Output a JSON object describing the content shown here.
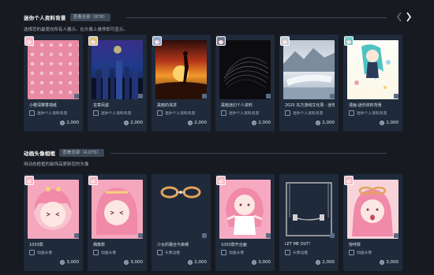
{
  "sections": [
    {
      "title": "迷你个人资料背景",
      "view_all": "查看全部（878）",
      "desc": "选择您的最爱向所有人展示。在头像上悬停即可显示。",
      "items": [
        {
          "name": "小樱深樱香墙纸",
          "type": "迷你个人资料背景",
          "price": "2,000"
        },
        {
          "name": "龙章凤姿",
          "type": "迷你个人资料背景",
          "price": "2,000"
        },
        {
          "name": "黑暗的渴求",
          "type": "迷你个人资料背景",
          "price": "2,000"
        },
        {
          "name": "黑暗迷幻个人资料",
          "type": "迷你个人资料背景",
          "price": "2,000"
        },
        {
          "name": "2020 东方游戏文化周 - 迷你",
          "type": "迷你个人资料背景",
          "price": "2,000"
        },
        {
          "name": "漫画-迷你资料背景",
          "type": "迷你个人资料背景",
          "price": "2,000"
        }
      ]
    },
    {
      "title": "动画头像相框",
      "view_all": "查看全部（4,075）",
      "desc": "用动态框框的装饰品更新您的头像",
      "items": [
        {
          "name": "1003款",
          "type": "动画头像",
          "price": "3,000"
        },
        {
          "name": "偶像款",
          "type": "动画头像",
          "price": "3,000"
        },
        {
          "name": "少女的蕾丝与束缚",
          "type": "头像边框",
          "price": "2,000"
        },
        {
          "name": "1003款开合面",
          "type": "动画头像",
          "price": "3,000"
        },
        {
          "name": "LET ME OUT!",
          "type": "头像边框",
          "price": "2,000"
        },
        {
          "name": "惊呼款",
          "type": "动画头像",
          "price": "3,000"
        }
      ]
    }
  ]
}
